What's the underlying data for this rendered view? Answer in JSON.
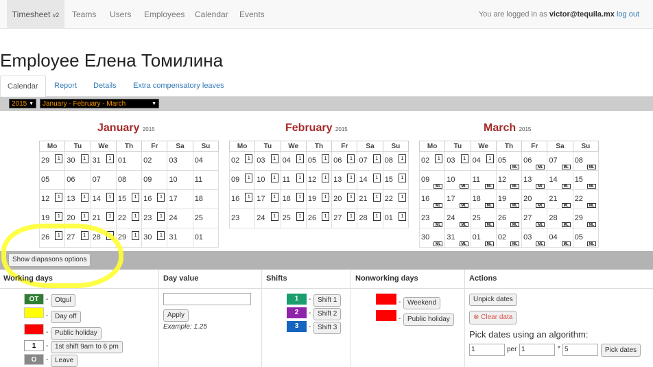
{
  "nav": {
    "brand": "Timesheet",
    "brand_version": "v2",
    "links": [
      "Teams",
      "Users",
      "Employees",
      "Calendar",
      "Events"
    ],
    "login_prefix": "You are logged in as",
    "login_user": "victor@tequila.mx",
    "logout": "log out"
  },
  "page_title": "Employee Елена Томилина",
  "tabs": [
    "Calendar",
    "Report",
    "Details",
    "Extra compensatory leaves"
  ],
  "year_select": "2015",
  "range_select": "January - February - March",
  "weekdays": [
    "Mo",
    "Tu",
    "We",
    "Th",
    "Fr",
    "Sa",
    "Su"
  ],
  "months": [
    {
      "name": "January",
      "year": "2015",
      "weeks": [
        [
          {
            "d": "29",
            "s": "dim",
            "t": "1"
          },
          {
            "d": "30",
            "s": "dim",
            "t": "1"
          },
          {
            "d": "31",
            "s": "dim",
            "t": "1"
          },
          {
            "d": "01",
            "s": "red"
          },
          {
            "d": "02",
            "s": "red"
          },
          {
            "d": "03",
            "s": "red"
          },
          {
            "d": "04",
            "s": "red"
          }
        ],
        [
          {
            "d": "05",
            "s": "red"
          },
          {
            "d": "06",
            "s": "red"
          },
          {
            "d": "07",
            "s": "red"
          },
          {
            "d": "08",
            "s": "red"
          },
          {
            "d": "09",
            "s": "red"
          },
          {
            "d": "10",
            "s": "red"
          },
          {
            "d": "11",
            "s": "red"
          }
        ],
        [
          {
            "d": "12",
            "t": "1"
          },
          {
            "d": "13",
            "t": "1"
          },
          {
            "d": "14",
            "t": "1"
          },
          {
            "d": "15",
            "t": "1"
          },
          {
            "d": "16",
            "t": "1"
          },
          {
            "d": "17",
            "s": "red"
          },
          {
            "d": "18",
            "s": "red"
          }
        ],
        [
          {
            "d": "19",
            "t": "1"
          },
          {
            "d": "20",
            "t": "1"
          },
          {
            "d": "21",
            "t": "1"
          },
          {
            "d": "22",
            "t": "1"
          },
          {
            "d": "23",
            "t": "1"
          },
          {
            "d": "24",
            "s": "red"
          },
          {
            "d": "25",
            "s": "red"
          }
        ],
        [
          {
            "d": "26",
            "t": "1"
          },
          {
            "d": "27",
            "t": "1"
          },
          {
            "d": "28",
            "t": "1"
          },
          {
            "d": "29",
            "t": "1"
          },
          {
            "d": "30",
            "t": "1"
          },
          {
            "d": "31",
            "s": "red"
          },
          {
            "d": "01",
            "s": "red"
          }
        ]
      ]
    },
    {
      "name": "February",
      "year": "2015",
      "weeks": [
        [
          {
            "d": "02",
            "t": "1"
          },
          {
            "d": "03",
            "t": "1"
          },
          {
            "d": "04",
            "t": "1"
          },
          {
            "d": "05",
            "t": "1"
          },
          {
            "d": "06",
            "t": "1"
          },
          {
            "d": "07",
            "t": "1"
          },
          {
            "d": "08",
            "t": "1"
          }
        ],
        [
          {
            "d": "09",
            "t": "1"
          },
          {
            "d": "10",
            "t": "1"
          },
          {
            "d": "11",
            "t": "1"
          },
          {
            "d": "12",
            "t": "1"
          },
          {
            "d": "13",
            "t": "1"
          },
          {
            "d": "14",
            "t": "1"
          },
          {
            "d": "15",
            "t": "1"
          }
        ],
        [
          {
            "d": "16",
            "t": "1"
          },
          {
            "d": "17",
            "t": "1"
          },
          {
            "d": "18",
            "t": "1"
          },
          {
            "d": "19",
            "t": "1"
          },
          {
            "d": "20",
            "t": "1"
          },
          {
            "d": "21",
            "t": "1"
          },
          {
            "d": "22",
            "t": "1"
          }
        ],
        [
          {
            "d": "23",
            "s": "red"
          },
          {
            "d": "24",
            "t": "1"
          },
          {
            "d": "25",
            "t": "1"
          },
          {
            "d": "26",
            "t": "1"
          },
          {
            "d": "27",
            "t": "1"
          },
          {
            "d": "28",
            "t": "1"
          },
          {
            "d": "01",
            "s": "dim",
            "t": "1"
          }
        ]
      ]
    },
    {
      "name": "March",
      "year": "2015",
      "weeks": [
        [
          {
            "d": "02",
            "t": "1"
          },
          {
            "d": "03",
            "t": "1"
          },
          {
            "d": "04",
            "t": "1"
          },
          {
            "d": "05",
            "m": "ML"
          },
          {
            "d": "06",
            "m": "ML"
          },
          {
            "d": "07",
            "m": "ML"
          },
          {
            "d": "08",
            "s": "red",
            "m": "ML"
          }
        ],
        [
          {
            "d": "09",
            "s": "red",
            "m": "ML"
          },
          {
            "d": "10",
            "m": "ML"
          },
          {
            "d": "11",
            "m": "ML"
          },
          {
            "d": "12",
            "m": "ML"
          },
          {
            "d": "13",
            "m": "ML"
          },
          {
            "d": "14",
            "m": "ML"
          },
          {
            "d": "15",
            "m": "ML"
          }
        ],
        [
          {
            "d": "16",
            "m": "ML"
          },
          {
            "d": "17",
            "m": "ML"
          },
          {
            "d": "18",
            "m": "ML"
          },
          {
            "d": "19",
            "m": "ML"
          },
          {
            "d": "20",
            "m": "ML"
          },
          {
            "d": "21",
            "m": "ML"
          },
          {
            "d": "22",
            "m": "ML"
          }
        ],
        [
          {
            "d": "23",
            "m": "ML"
          },
          {
            "d": "24",
            "m": "ML"
          },
          {
            "d": "25",
            "m": "ML"
          },
          {
            "d": "26",
            "m": "ML"
          },
          {
            "d": "27",
            "m": "ML"
          },
          {
            "d": "28",
            "m": "ML"
          },
          {
            "d": "29",
            "m": "ML"
          }
        ],
        [
          {
            "d": "30",
            "m": "ML"
          },
          {
            "d": "31",
            "m": "ML"
          },
          {
            "d": "01",
            "s": "dim",
            "m": "ML"
          },
          {
            "d": "02",
            "s": "dim",
            "m": "ML"
          },
          {
            "d": "03",
            "s": "dim",
            "m": "ML"
          },
          {
            "d": "04",
            "s": "dim",
            "m": "ML"
          },
          {
            "d": "05",
            "s": "dim",
            "m": "ML"
          }
        ]
      ]
    }
  ],
  "diapasons_button": "Show diapasons options",
  "headers": {
    "working_days": "Working days",
    "day_value": "Day value",
    "shifts": "Shifts",
    "nonworking_days": "Nonworking days",
    "actions": "Actions"
  },
  "working_days": [
    {
      "swatch": "OT",
      "color": "#2e7d32",
      "text_color": "#ffffff",
      "label": "Otgul"
    },
    {
      "swatch": "",
      "color": "#ffff00",
      "text_color": "#000000",
      "label": "Day off"
    },
    {
      "swatch": "",
      "color": "#ff0000",
      "text_color": "#ffffff",
      "label": "Public holiday"
    },
    {
      "swatch": "1",
      "color": "#ffffff",
      "text_color": "#000000",
      "label": "1st shift 9am to 6 pm"
    },
    {
      "swatch": "O",
      "color": "#888888",
      "text_color": "#ffffff",
      "label": "Leave"
    }
  ],
  "day_value": {
    "apply": "Apply",
    "example": "Example: 1.25"
  },
  "shifts": [
    {
      "swatch": "1",
      "color": "#1a9e6e",
      "label": "Shift 1"
    },
    {
      "swatch": "2",
      "color": "#8e24aa",
      "label": "Shift 2"
    },
    {
      "swatch": "3",
      "color": "#1565c0",
      "label": "Shift 3"
    }
  ],
  "nonworking": [
    {
      "color": "#ff0000",
      "label": "Weekend"
    },
    {
      "color": "#ff0000",
      "label": "Public holiday"
    }
  ],
  "actions": {
    "unpick": "Unpick dates",
    "clear": "Clear data",
    "algo_label": "Pick dates using an algorithm:",
    "from": "1",
    "per_label": "per",
    "per": "1",
    "mult_label": "*",
    "mult": "5",
    "pick": "Pick dates"
  },
  "colors": {
    "month_title": "#a52a2a",
    "holiday": "#ff0000",
    "select_text": "#ff9900",
    "highlight": "#ffff33"
  }
}
